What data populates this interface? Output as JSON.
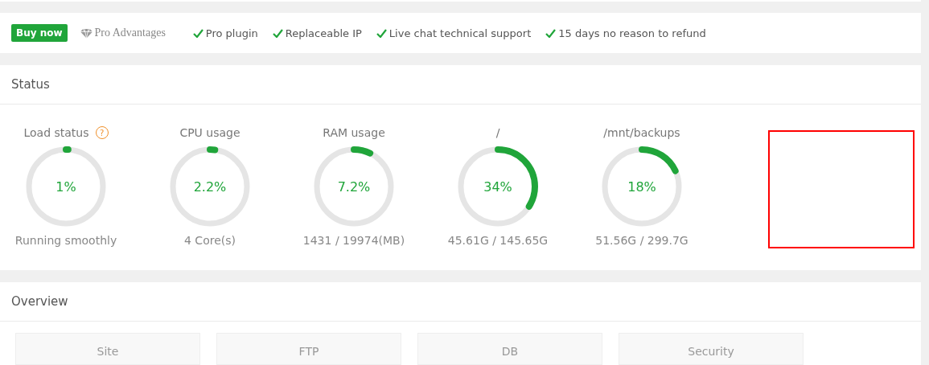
{
  "promo": {
    "buy_button": "Buy now",
    "advantages_label": "Pro Advantages",
    "features": [
      "Pro plugin",
      "Replaceable IP",
      "Live chat technical support",
      "15 days no reason to refund"
    ]
  },
  "status": {
    "title": "Status",
    "gauges": [
      {
        "label": "Load status",
        "help": "?",
        "level": 0.01,
        "reading": "1%",
        "detail": "Running smoothly"
      },
      {
        "label": "CPU usage",
        "level": 0.022,
        "reading": "2.2%",
        "detail": "4 Core(s)"
      },
      {
        "label": "RAM usage",
        "level": 0.072,
        "reading": "7.2%",
        "detail": "1431 / 19974(MB)"
      },
      {
        "label": "/",
        "level": 0.34,
        "reading": "34%",
        "detail": "45.61G / 145.65G"
      },
      {
        "label": "/mnt/backups",
        "level": 0.18,
        "reading": "18%",
        "detail": "51.56G / 299.7G"
      }
    ]
  },
  "overview": {
    "title": "Overview",
    "cards": [
      "Site",
      "FTP",
      "DB",
      "Security"
    ]
  }
}
